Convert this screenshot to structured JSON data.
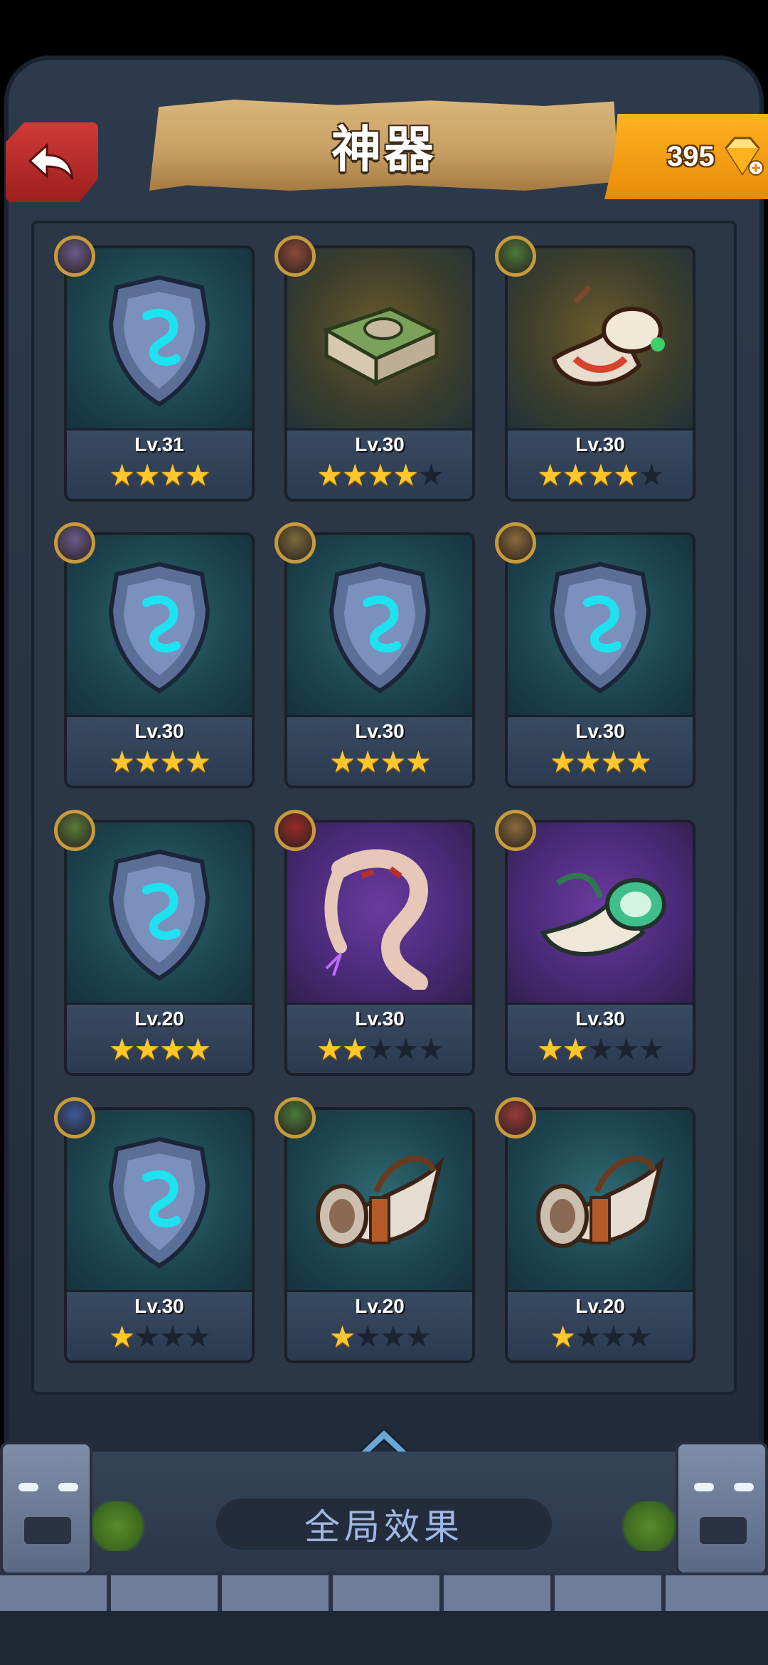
{
  "header": {
    "title": "神器"
  },
  "currency": {
    "gems": "395"
  },
  "artifacts": [
    {
      "level": "Lv.31",
      "stars": 4,
      "max_stars": 4,
      "art": "shield-icon",
      "bg": "teal"
    },
    {
      "level": "Lv.30",
      "stars": 4,
      "max_stars": 5,
      "art": "spellbook-icon",
      "bg": "gold"
    },
    {
      "level": "Lv.30",
      "stars": 4,
      "max_stars": 5,
      "art": "drum-horn-icon",
      "bg": "gold"
    },
    {
      "level": "Lv.30",
      "stars": 4,
      "max_stars": 4,
      "art": "shield-icon",
      "bg": "teal"
    },
    {
      "level": "Lv.30",
      "stars": 4,
      "max_stars": 4,
      "art": "shield-icon",
      "bg": "teal"
    },
    {
      "level": "Lv.30",
      "stars": 4,
      "max_stars": 4,
      "art": "shield-icon",
      "bg": "teal"
    },
    {
      "level": "Lv.20",
      "stars": 4,
      "max_stars": 4,
      "art": "shield-icon",
      "bg": "teal"
    },
    {
      "level": "Lv.30",
      "stars": 2,
      "max_stars": 5,
      "art": "claw-icon",
      "bg": "purple"
    },
    {
      "level": "Lv.30",
      "stars": 2,
      "max_stars": 5,
      "art": "jade-horn-icon",
      "bg": "purple"
    },
    {
      "level": "Lv.30",
      "stars": 1,
      "max_stars": 4,
      "art": "shield-icon",
      "bg": "teal"
    },
    {
      "level": "Lv.20",
      "stars": 1,
      "max_stars": 4,
      "art": "war-horn-icon",
      "bg": "teal"
    },
    {
      "level": "Lv.20",
      "stars": 1,
      "max_stars": 4,
      "art": "war-horn-icon",
      "bg": "teal"
    }
  ],
  "footer": {
    "effects_label": "全局效果"
  },
  "colors": {
    "star_on": "#ffc72c",
    "star_off": "#1a2330",
    "accent_gold": "#e88a07",
    "back_red": "#d03a36"
  }
}
